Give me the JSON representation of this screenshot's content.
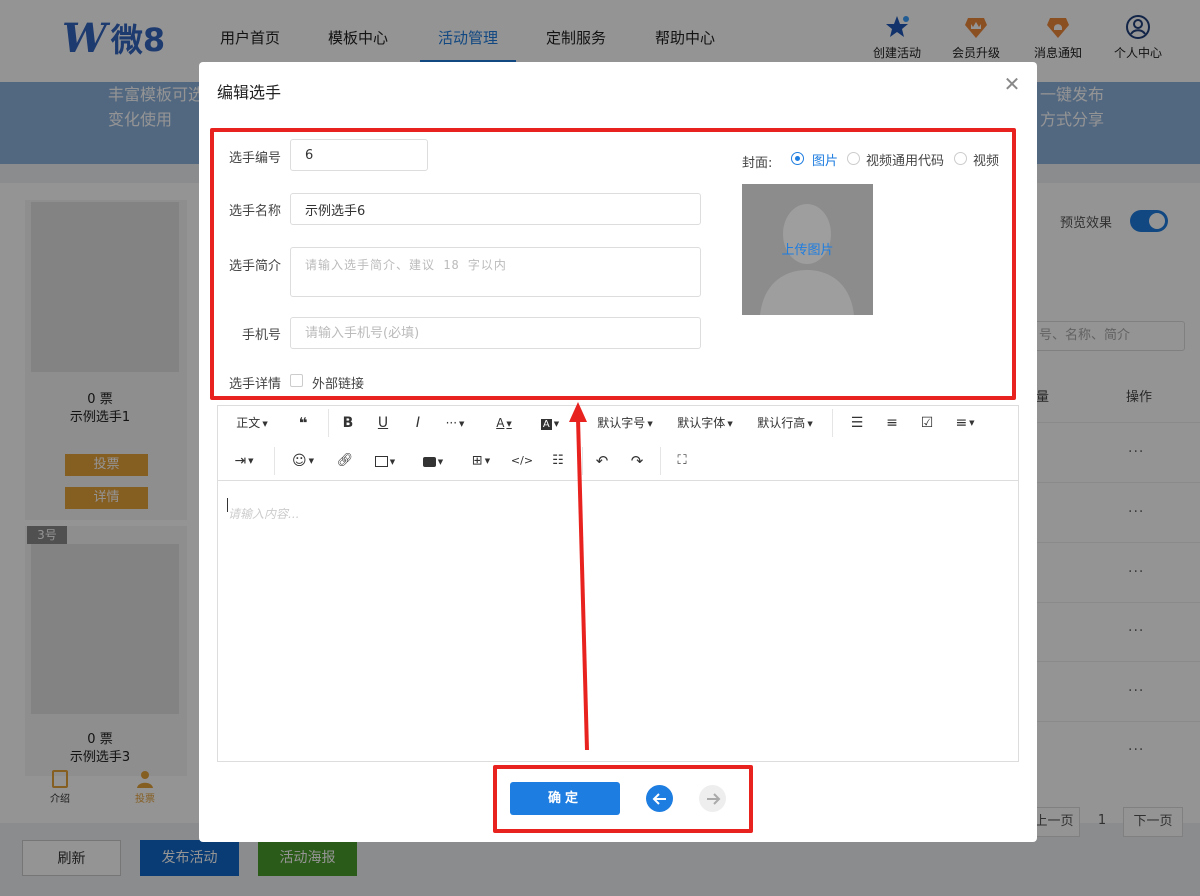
{
  "brand": {
    "logo_letter": "W",
    "logo_text": "微8"
  },
  "nav": [
    "用户首页",
    "模板中心",
    "活动管理",
    "定制服务",
    "帮助中心"
  ],
  "top_actions": [
    {
      "label": "创建活动",
      "icon": "star-icon"
    },
    {
      "label": "会员升级",
      "icon": "crown-badge-icon"
    },
    {
      "label": "消息通知",
      "icon": "bell-badge-icon"
    },
    {
      "label": "个人中心",
      "icon": "user-circle-icon"
    }
  ],
  "banner": {
    "left_line1": "丰富模板可选",
    "left_line2": "变化使用",
    "right_line1": "一键发布",
    "right_line2": "方式分享"
  },
  "cards": [
    {
      "votes": "0 票",
      "name": "示例选手1",
      "vote_btn": "投票",
      "detail_btn": "详情"
    },
    {
      "num": "3号",
      "votes": "0 票",
      "name": "示例选手3"
    }
  ],
  "mobile_tabs": [
    "介绍",
    "投票"
  ],
  "preview_label": "预览效果",
  "search_placeholder": "号、名称、简介",
  "table_headers": {
    "count": "量",
    "action": "操作"
  },
  "row_more": "···",
  "pagination": {
    "prev": "上一页",
    "page": "1",
    "next": "下一页"
  },
  "footer_buttons": {
    "refresh": "刷新",
    "publish": "发布活动",
    "poster": "活动海报"
  },
  "modal": {
    "title": "编辑选手",
    "fields": {
      "number_label": "选手编号",
      "number_value": "6",
      "name_label": "选手名称",
      "name_value": "示例选手6",
      "intro_label": "选手简介",
      "intro_placeholder": "请输入选手简介、建议 18 字以内",
      "phone_label": "手机号",
      "phone_placeholder": "请输入手机号(必填)",
      "detail_label": "选手详情",
      "external_link_label": "外部链接"
    },
    "cover": {
      "label": "封面:",
      "options": [
        "图片",
        "视频通用代码",
        "视频"
      ],
      "selected": "图片",
      "upload_text": "上传图片"
    },
    "toolbar": {
      "paragraph": "正文",
      "font_size": "默认字号",
      "font_family": "默认字体",
      "line_height": "默认行高"
    },
    "editor_placeholder": "请输入内容...",
    "confirm": "确定"
  },
  "colors": {
    "primary": "#1e7de0",
    "highlight": "#e8231f",
    "vote_button": "#e6a23c",
    "publish_button": "#1068c8",
    "poster_button": "#4a9e2c"
  }
}
